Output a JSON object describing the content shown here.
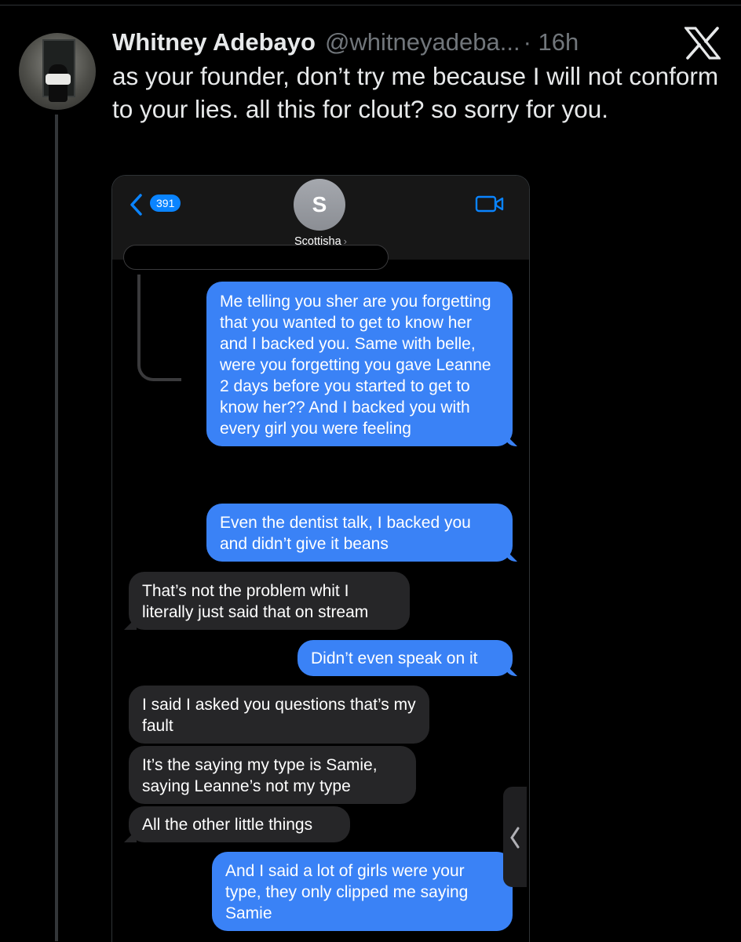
{
  "tweet": {
    "author_name": "Whitney Adebayo",
    "handle": "@whitneyadeba...",
    "time": "· 16h",
    "text": "as your founder, don’t try me because I will not conform to your lies. all this for clout? so sorry for you."
  },
  "icons": {
    "logo": "x-logo-icon",
    "back": "chevron-left-icon",
    "video": "video-camera-icon",
    "collapse": "chevron-left-icon"
  },
  "colors": {
    "sent_bubble": "#3a82f6",
    "received_bubble": "#262628",
    "badge": "#0a84ff",
    "background": "#000000"
  },
  "imessage": {
    "unread_count": "391",
    "contact_initial": "S",
    "contact_name": "Scottisha",
    "contact_chevron": "›",
    "messages": [
      {
        "from": "me",
        "text": "Me telling you sher are you forgetting that you wanted to get to know her and I backed you. Same with belle, were you forgetting you gave Leanne 2 days before you started to get to know her?? And I backed you with every girl you were feeling"
      },
      {
        "from": "me",
        "text": "Even the dentist talk, I backed you and didn’t give it beans"
      },
      {
        "from": "them",
        "text": "That’s not the problem whit I literally just said that on stream"
      },
      {
        "from": "me",
        "text": "Didn’t even speak on it"
      },
      {
        "from": "them",
        "text": "I said I asked you questions that’s my fault"
      },
      {
        "from": "them",
        "text": "It’s the saying my type is Samie, saying Leanne’s not my type"
      },
      {
        "from": "them",
        "text": "All the other little things"
      },
      {
        "from": "me",
        "text": "And I said a lot of girls were your type, they only clipped me saying Samie"
      }
    ]
  }
}
